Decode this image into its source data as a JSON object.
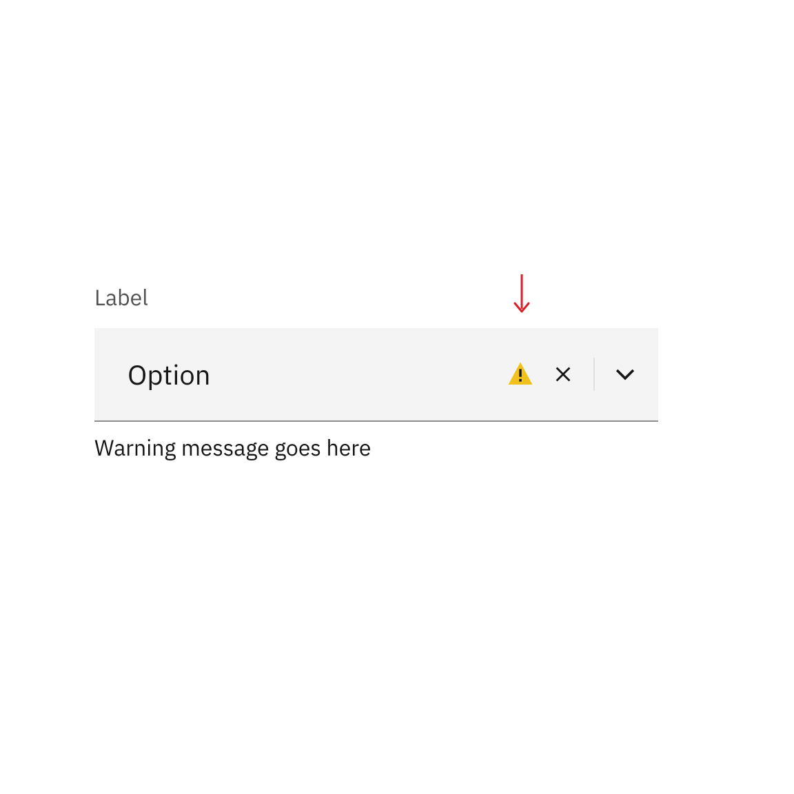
{
  "field": {
    "label": "Label",
    "value": "Option",
    "helper": "Warning message goes here"
  }
}
